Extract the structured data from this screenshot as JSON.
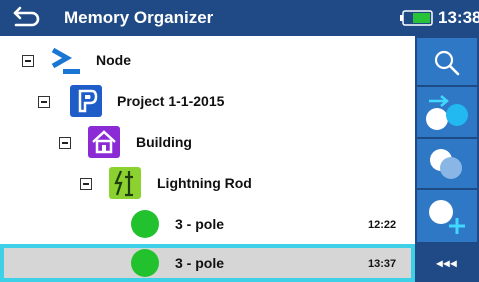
{
  "header": {
    "title": "Memory Organizer",
    "time": "13:38",
    "back_icon": "back-arrow-icon",
    "battery_icon": "battery-icon",
    "background": "#1f4a85"
  },
  "tree": {
    "node": {
      "label": "Node",
      "icon": "prompt-icon"
    },
    "project": {
      "label": "Project 1-1-2015",
      "icon": "project-icon"
    },
    "building": {
      "label": "Building",
      "icon": "house-icon"
    },
    "lightning_rod": {
      "label": "Lightning Rod",
      "icon": "lightning-rod-icon"
    },
    "measurements": [
      {
        "label": "3 - pole",
        "time": "12:22",
        "status": "passed",
        "selected": false
      },
      {
        "label": "3 - pole",
        "time": "13:37",
        "status": "passed",
        "selected": true
      }
    ]
  },
  "toolbar": {
    "search_icon": "search-icon",
    "go_to_location_icon": "go-to-location-icon",
    "clone_icon": "clone-icon",
    "add_icon": "add-measurement-icon",
    "collapse_label": "◂◂◂"
  },
  "colors": {
    "header": "#1f4a85",
    "toolbar_button": "#2f78c6",
    "selection_border": "#3ed0e6",
    "selection_fill": "#d6d6d6",
    "status_pass": "#22c22e"
  }
}
